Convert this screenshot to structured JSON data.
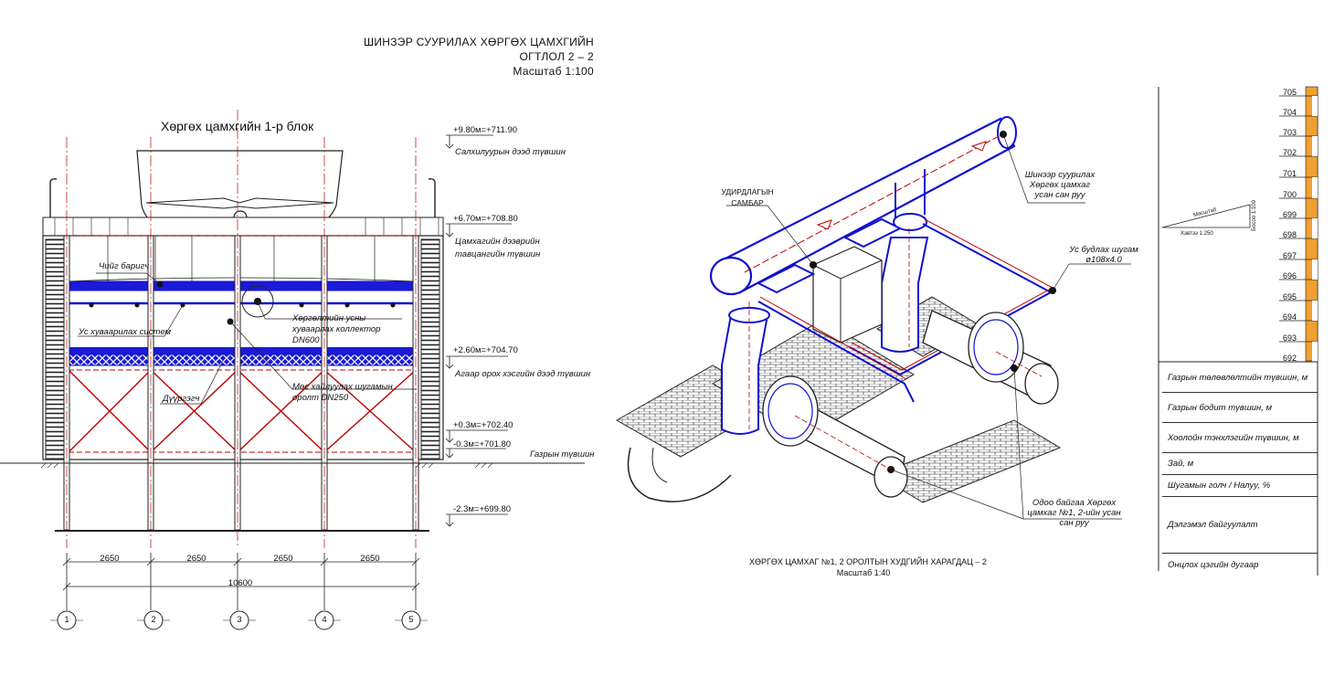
{
  "section_title": {
    "line1": "ШИНЗЭР СУУРИЛАХ ХӨРГӨХ ЦАМХГИЙН ОГТЛОЛ 2 – 2",
    "line2": "Масштаб 1:100"
  },
  "block_title": "Хөргөх цамхгийн 1-р блок",
  "levels": [
    {
      "mark": "+9.80м=+711.90",
      "label": "Салхилуурын дээд түвшин"
    },
    {
      "mark": "+6.70м=+708.80",
      "label": "Цамхагийн дээврийн тавцангийн түвшин"
    },
    {
      "mark": "+2.60м=+704.70",
      "label": "Агаар орох хэсгийн дээд түвшин"
    },
    {
      "mark": "+0.3м=+702.40",
      "label": ""
    },
    {
      "mark": "-0.3м=+701.80",
      "label": "Газрын түвшин"
    },
    {
      "mark": "-2.3м=+699.80",
      "label": ""
    }
  ],
  "callouts": {
    "droplet": "Чийг баригч",
    "water_dist": "Ус хуваарилах систем",
    "collector": "Хөргөлтийн усны хуваарлах коллектор DN600",
    "filler": "Дүүргэгч",
    "pipe_inlet": "Мөс хайлуулах шугамын оролт DN250"
  },
  "dimensions": {
    "spans": [
      "2650",
      "2650",
      "2650",
      "2650"
    ],
    "total": "10600",
    "axes": [
      "1",
      "2",
      "3",
      "4",
      "5"
    ]
  },
  "iso": {
    "control_panel": "УДИРДЛАГЫН САМБАР",
    "outlet_pipe": "Шинээр суурилах Хөргөх цамхаг усан сан руу",
    "flush_pipe": "Ус будлах шугам ø108x4.0",
    "existing_pipe": "Одоо байгаа Хөргөх цамхаг №1, 2-ийн усан сан руу",
    "caption1": "ХӨРГӨХ ЦАМХАГ №1, 2 ОРОЛТЫН ХУДГИЙН ХАРАГДАЦ – 2",
    "caption2": "Масштаб 1:40"
  },
  "profile": {
    "scale_text": "Масштаб",
    "horiz": "Хэвтээ 1:250",
    "vert": "Босоо 1:100",
    "elevations": [
      "705",
      "704",
      "703",
      "702",
      "701",
      "700",
      "699",
      "698",
      "697",
      "696",
      "695",
      "694",
      "693",
      "692"
    ],
    "rows": [
      "Газрын төлөвлөлтийн түвшин, м",
      "Газрын бодит түвшин, м",
      "Хоолойн тэнхлэгийн түвшин, м",
      "Зай, м",
      "Шугамын голч / Налуу, %",
      "Дэлгэмэл байгуулалт",
      "Онцлох цэгийн дугаар"
    ]
  },
  "colors": {
    "frame_red": "#c00000",
    "pipe_blue": "#1010d0",
    "fill_blue": "#1a1ad8",
    "profile_orange": "#f0a030"
  }
}
